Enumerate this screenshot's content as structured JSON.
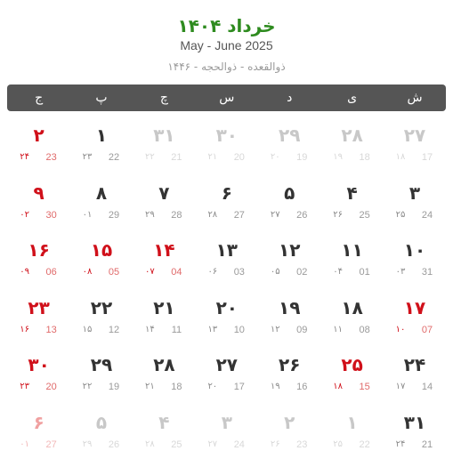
{
  "header": {
    "persian_month": "خرداد ۱۴۰۴",
    "gregorian_months": "May - June 2025",
    "hijri_months": "ذوالقعده - ذوالحجه - ۱۴۴۶"
  },
  "weekdays": [
    "ش",
    "ی",
    "د",
    "س",
    "چ",
    "پ",
    "ج"
  ],
  "colors": {
    "title": "#2e8b1f",
    "holiday": "#d0101a",
    "weekbar": "#555555",
    "day_text": "#333333",
    "muted": "#c8c8c8"
  },
  "weeks": [
    [
      {
        "day": "۲۷",
        "hijri": "۱۸",
        "greg": "17",
        "muted": true,
        "holiday": false
      },
      {
        "day": "۲۸",
        "hijri": "۱۹",
        "greg": "18",
        "muted": true,
        "holiday": false
      },
      {
        "day": "۲۹",
        "hijri": "۲۰",
        "greg": "19",
        "muted": true,
        "holiday": false
      },
      {
        "day": "۳۰",
        "hijri": "۲۱",
        "greg": "20",
        "muted": true,
        "holiday": false
      },
      {
        "day": "۳۱",
        "hijri": "۲۲",
        "greg": "21",
        "muted": true,
        "holiday": false
      },
      {
        "day": "۱",
        "hijri": "۲۳",
        "greg": "22",
        "muted": false,
        "holiday": false
      },
      {
        "day": "۲",
        "hijri": "۲۴",
        "greg": "23",
        "muted": false,
        "holiday": true
      }
    ],
    [
      {
        "day": "۳",
        "hijri": "۲۵",
        "greg": "24",
        "muted": false,
        "holiday": false
      },
      {
        "day": "۴",
        "hijri": "۲۶",
        "greg": "25",
        "muted": false,
        "holiday": false
      },
      {
        "day": "۵",
        "hijri": "۲۷",
        "greg": "26",
        "muted": false,
        "holiday": false
      },
      {
        "day": "۶",
        "hijri": "۲۸",
        "greg": "27",
        "muted": false,
        "holiday": false
      },
      {
        "day": "۷",
        "hijri": "۲۹",
        "greg": "28",
        "muted": false,
        "holiday": false
      },
      {
        "day": "۸",
        "hijri": "۰۱",
        "greg": "29",
        "muted": false,
        "holiday": false
      },
      {
        "day": "۹",
        "hijri": "۰۲",
        "greg": "30",
        "muted": false,
        "holiday": true
      }
    ],
    [
      {
        "day": "۱۰",
        "hijri": "۰۳",
        "greg": "31",
        "muted": false,
        "holiday": false
      },
      {
        "day": "۱۱",
        "hijri": "۰۴",
        "greg": "01",
        "muted": false,
        "holiday": false
      },
      {
        "day": "۱۲",
        "hijri": "۰۵",
        "greg": "02",
        "muted": false,
        "holiday": false
      },
      {
        "day": "۱۳",
        "hijri": "۰۶",
        "greg": "03",
        "muted": false,
        "holiday": false
      },
      {
        "day": "۱۴",
        "hijri": "۰۷",
        "greg": "04",
        "muted": false,
        "holiday": true
      },
      {
        "day": "۱۵",
        "hijri": "۰۸",
        "greg": "05",
        "muted": false,
        "holiday": true
      },
      {
        "day": "۱۶",
        "hijri": "۰۹",
        "greg": "06",
        "muted": false,
        "holiday": true
      }
    ],
    [
      {
        "day": "۱۷",
        "hijri": "۱۰",
        "greg": "07",
        "muted": false,
        "holiday": true
      },
      {
        "day": "۱۸",
        "hijri": "۱۱",
        "greg": "08",
        "muted": false,
        "holiday": false
      },
      {
        "day": "۱۹",
        "hijri": "۱۲",
        "greg": "09",
        "muted": false,
        "holiday": false
      },
      {
        "day": "۲۰",
        "hijri": "۱۳",
        "greg": "10",
        "muted": false,
        "holiday": false
      },
      {
        "day": "۲۱",
        "hijri": "۱۴",
        "greg": "11",
        "muted": false,
        "holiday": false
      },
      {
        "day": "۲۲",
        "hijri": "۱۵",
        "greg": "12",
        "muted": false,
        "holiday": false
      },
      {
        "day": "۲۳",
        "hijri": "۱۶",
        "greg": "13",
        "muted": false,
        "holiday": true
      }
    ],
    [
      {
        "day": "۲۴",
        "hijri": "۱۷",
        "greg": "14",
        "muted": false,
        "holiday": false
      },
      {
        "day": "۲۵",
        "hijri": "۱۸",
        "greg": "15",
        "muted": false,
        "holiday": true
      },
      {
        "day": "۲۶",
        "hijri": "۱۹",
        "greg": "16",
        "muted": false,
        "holiday": false
      },
      {
        "day": "۲۷",
        "hijri": "۲۰",
        "greg": "17",
        "muted": false,
        "holiday": false
      },
      {
        "day": "۲۸",
        "hijri": "۲۱",
        "greg": "18",
        "muted": false,
        "holiday": false
      },
      {
        "day": "۲۹",
        "hijri": "۲۲",
        "greg": "19",
        "muted": false,
        "holiday": false
      },
      {
        "day": "۳۰",
        "hijri": "۲۳",
        "greg": "20",
        "muted": false,
        "holiday": true
      }
    ],
    [
      {
        "day": "۳۱",
        "hijri": "۲۴",
        "greg": "21",
        "muted": false,
        "holiday": false
      },
      {
        "day": "۱",
        "hijri": "۲۵",
        "greg": "22",
        "muted": true,
        "holiday": false
      },
      {
        "day": "۲",
        "hijri": "۲۶",
        "greg": "23",
        "muted": true,
        "holiday": false
      },
      {
        "day": "۳",
        "hijri": "۲۷",
        "greg": "24",
        "muted": true,
        "holiday": false
      },
      {
        "day": "۴",
        "hijri": "۲۸",
        "greg": "25",
        "muted": true,
        "holiday": false
      },
      {
        "day": "۵",
        "hijri": "۲۹",
        "greg": "26",
        "muted": true,
        "holiday": false
      },
      {
        "day": "۶",
        "hijri": "۰۱",
        "greg": "27",
        "muted": true,
        "holiday": true
      }
    ]
  ]
}
